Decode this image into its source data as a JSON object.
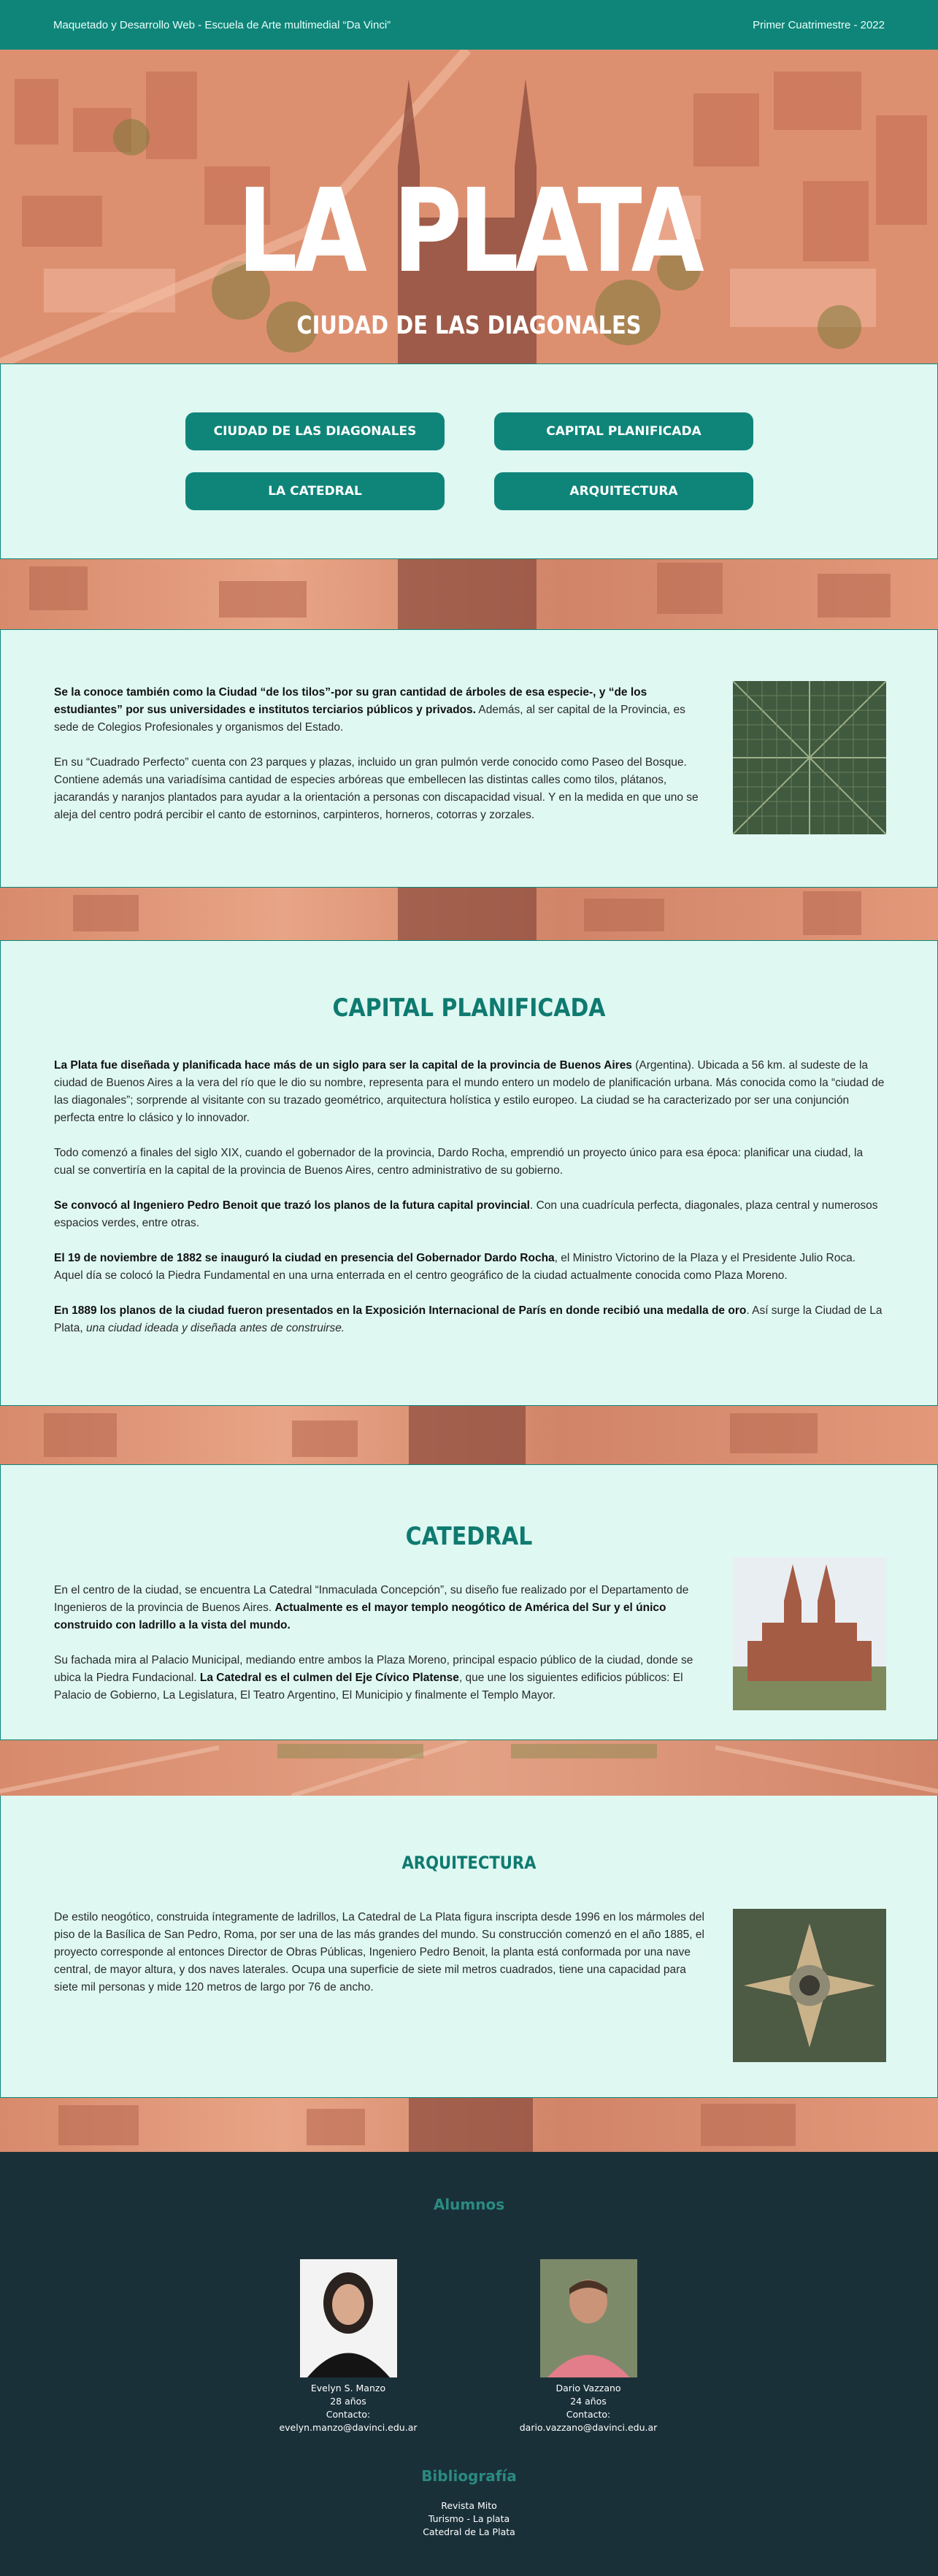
{
  "header": {
    "left": "Maquetado y Desarrollo Web - Escuela de Arte multimedial “Da Vinci”",
    "right": "Primer Cuatrimestre - 2022"
  },
  "hero": {
    "title": "LA PLATA",
    "subtitle": "CIUDAD DE LAS DIAGONALES"
  },
  "nav": {
    "b1": "CIUDAD DE LAS DIAGONALES",
    "b2": "CAPITAL PLANIFICADA",
    "b3": "LA CATEDRAL",
    "b4": "ARQUITECTURA"
  },
  "intro": {
    "p1_b": "Se la conoce también como la Ciudad “de los tilos”-por su gran cantidad de árboles de esa especie-, y “de los estudiantes” por sus universidades e institutos terciarios públicos y privados.",
    "p1": " Además, al ser capital de la Provincia, es sede de Colegios Profesionales y organismos del Estado.",
    "p2": "En su “Cuadrado Perfecto” cuenta con 23 parques y plazas, incluido un gran pulmón verde conocido como Paseo del Bosque. Contiene además una variadísima cantidad de especies arbóreas que embellecen las distintas calles como tilos, plátanos, jacarandás y naranjos plantados para ayudar a la orientación a personas con discapacidad visual. Y en la medida en que uno se aleja del centro podrá percibir el canto de estorninos, carpinteros, horneros, cotorras y zorzales."
  },
  "capital": {
    "title": "CAPITAL PLANIFICADA",
    "p1_b": "La Plata fue diseñada y planificada hace más de un siglo para ser la capital de la provincia de Buenos Aires",
    "p1": " (Argentina). Ubicada a 56 km. al sudeste de la ciudad de Buenos Aires a la vera del río que le dio su nombre, representa para el mundo entero un modelo de planificación urbana. Más conocida como la “ciudad de las diagonales”; sorprende al visitante con su trazado geométrico, arquitectura holística y estilo europeo. La ciudad se ha caracterizado por ser una conjunción perfecta entre lo clásico y lo innovador.",
    "p2": "Todo comenzó a finales del siglo XIX, cuando el gobernador de la provincia, Dardo Rocha, emprendió un proyecto único para esa época: planificar una ciudad, la cual se convertiría en la capital de la provincia de Buenos Aires, centro administrativo de su gobierno.",
    "p3_b": "Se convocó al Ingeniero Pedro Benoit que trazó los planos de la futura capital provincial",
    "p3": ". Con una cuadrícula perfecta, diagonales, plaza central y numerosos espacios verdes, entre otras.",
    "p4_b": "El 19 de noviembre de 1882 se inauguró la ciudad en presencia del Gobernador Dardo Rocha",
    "p4": ", el Ministro Victorino de la Plaza y el Presidente Julio Roca. Aquel día se colocó la Piedra Fundamental en una urna enterrada en el centro geográfico de la ciudad actualmente conocida como Plaza Moreno.",
    "p5_b": "En 1889 los planos de la ciudad fueron presentados en la Exposición Internacional de París en donde recibió una medalla de oro",
    "p5": ". Así surge la Ciudad de La Plata, ",
    "p5_i": "una ciudad ideada y diseñada antes de construirse."
  },
  "catedral": {
    "title": "CATEDRAL",
    "p1": "En el centro de la ciudad, se encuentra La Catedral “Inmaculada Concepción”, su diseño fue realizado por el Departamento de Ingenieros de la provincia de Buenos Aires. ",
    "p1_b": "Actualmente es el mayor templo neogótico de América del Sur y el único construido con ladrillo a la vista del mundo.",
    "p2": "Su fachada mira al Palacio Municipal, mediando entre ambos la Plaza Moreno, principal espacio público de la ciudad, donde se ubica la Piedra Fundacional. ",
    "p2_b": "La Catedral es el culmen del Eje Cívico Platense",
    "p2_c": ", que une los siguientes edificios públicos: El Palacio de Gobierno, La Legislatura, El Teatro Argentino, El Municipio y finalmente el Templo Mayor."
  },
  "arq": {
    "title": "ARQUITECTURA",
    "p1": "De estilo neogótico, construida íntegramente de ladrillos, La Catedral de La Plata figura inscripta desde 1996 en los mármoles del piso de la Basílica de San Pedro, Roma, por ser una de las más grandes del mundo. Su construcción comenzó en el año 1885, el proyecto corresponde al entonces Director de Obras Públicas, Ingeniero Pedro Benoit, la planta está conformada por una nave central, de mayor altura, y dos naves laterales. Ocupa una superficie de siete mil metros cuadrados, tiene una capacidad para siete mil personas y mide 120 metros de largo por 76 de ancho."
  },
  "footer": {
    "alumnos": "Alumnos",
    "a1": {
      "name": "Evelyn S. Manzo",
      "age": "28 años",
      "contact": "Contacto: evelyn.manzo@davinci.edu.ar"
    },
    "a2": {
      "name": "Dario Vazzano",
      "age": "24 años",
      "contact": "Contacto: dario.vazzano@davinci.edu.ar"
    },
    "bib": "Bibliografía",
    "refs": [
      "Revista Mito",
      "Turismo - La plata",
      "Catedral de La Plata"
    ]
  }
}
